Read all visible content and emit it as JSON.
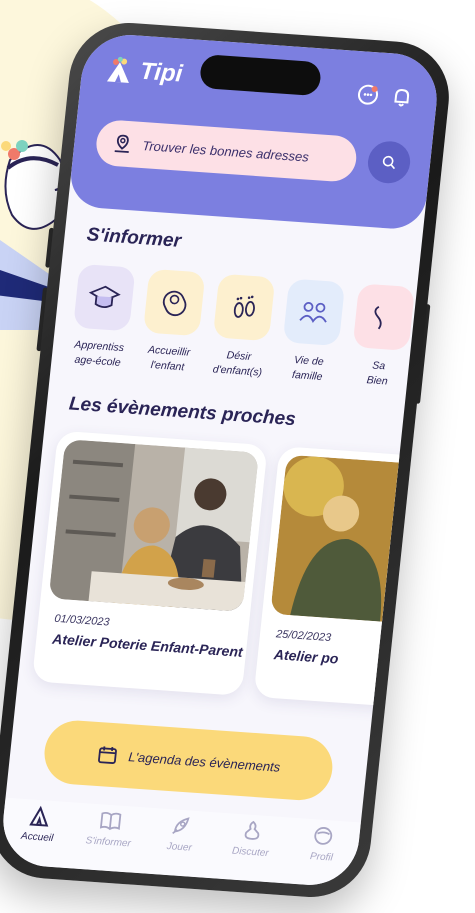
{
  "app": {
    "name": "Tipi"
  },
  "colors": {
    "header_bg": "#7c7fe0",
    "search_pill_bg": "#fde0e6",
    "search_button_bg": "#5c5fc4",
    "agenda_bg": "#fbd97a",
    "active_tab": "#2a2456",
    "inactive_tab": "#a8a6c4",
    "background_accent": "#fdf7dc"
  },
  "header": {
    "search_label": "Trouver les bonnes adresses",
    "icons": [
      "chat-bot-icon",
      "bell-icon"
    ]
  },
  "inform": {
    "title": "S'informer",
    "categories": [
      {
        "label_line1": "Apprentiss",
        "label_line2": "age-école",
        "icon": "graduation-cap-icon"
      },
      {
        "label_line1": "Accueillir",
        "label_line2": "l'enfant",
        "icon": "baby-icon"
      },
      {
        "label_line1": "Désir",
        "label_line2": "d'enfant(s)",
        "icon": "footprints-icon"
      },
      {
        "label_line1": "Vie de",
        "label_line2": "famille",
        "icon": "family-icon"
      },
      {
        "label_line1": "Sa",
        "label_line2": "Bien",
        "icon": "health-icon"
      }
    ]
  },
  "events": {
    "title": "Les évènements proches",
    "items": [
      {
        "date": "01/03/2023",
        "title": "Atelier Poterie Enfant-Parent"
      },
      {
        "date": "25/02/2023",
        "title": "Atelier po"
      }
    ]
  },
  "agenda": {
    "label": "L'agenda des évènements"
  },
  "tabs": [
    {
      "label": "Accueil",
      "icon": "tent-icon",
      "active": true
    },
    {
      "label": "S'informer",
      "icon": "book-icon",
      "active": false
    },
    {
      "label": "Jouer",
      "icon": "rocket-icon",
      "active": false
    },
    {
      "label": "Discuter",
      "icon": "chat-icon",
      "active": false
    },
    {
      "label": "Profil",
      "icon": "profile-icon",
      "active": false
    }
  ]
}
